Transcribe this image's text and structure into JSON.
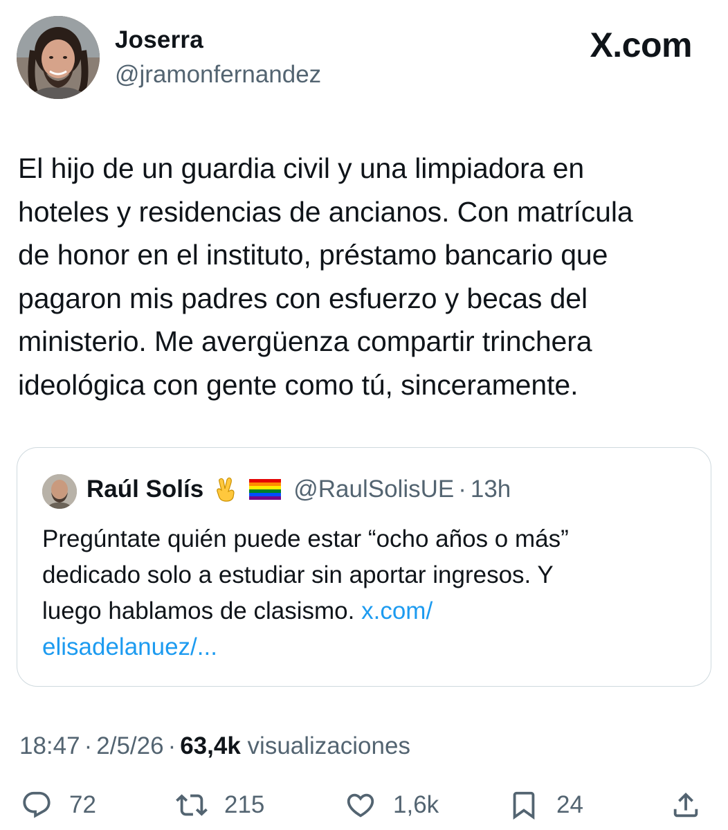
{
  "author": {
    "name": "Joserra",
    "handle": "@jramonfernandez"
  },
  "brand": "X.com",
  "tweet_lines": [
    "El hijo de un guardia civil y una limpiadora en",
    "hoteles y residencias de ancianos. Con matrícula",
    "de honor en el instituto, préstamo bancario que",
    "pagaron mis padres con esfuerzo y becas del",
    "ministerio. Me avergüenza compartir trinchera",
    "ideológica con gente como tú, sinceramente."
  ],
  "quote": {
    "name": "Raúl Solís",
    "handle": "@RaulSolisUE",
    "time": "13h",
    "text_lines": [
      "Pregúntate quién puede estar “ocho años o más”",
      "dedicado solo a estudiar sin aportar ingresos. Y",
      "luego hablamos de clasismo. "
    ],
    "link_part1": "x.com/",
    "link_part2": "elisadelanuez/..."
  },
  "meta": {
    "time": "18:47",
    "date": "2/5/26",
    "views_count": "63,4k",
    "views_label": "visualizaciones"
  },
  "actions": {
    "replies": "72",
    "reposts": "215",
    "likes": "1,6k",
    "bookmarks": "24"
  },
  "colors": {
    "text": "#0f1419",
    "secondary": "#536471",
    "link": "#1d9bf0",
    "border": "#cfd9de"
  },
  "icons": [
    "x-logo-icon",
    "victory-hand-emoji-icon",
    "rainbow-flag-emoji-icon",
    "reply-icon",
    "repost-icon",
    "like-icon",
    "bookmark-icon",
    "share-icon"
  ]
}
